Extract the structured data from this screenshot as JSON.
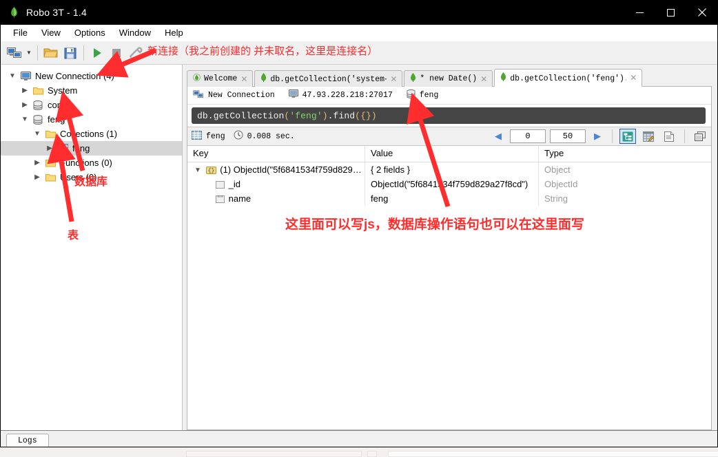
{
  "window": {
    "title": "Robo 3T - 1.4",
    "app_icon": "robomongo-leaf-icon",
    "controls": {
      "minimize": "─",
      "maximize": "□",
      "close": "✕"
    }
  },
  "menu": {
    "items": [
      {
        "label": "File"
      },
      {
        "label": "View"
      },
      {
        "label": "Options"
      },
      {
        "label": "Window"
      },
      {
        "label": "Help"
      }
    ]
  },
  "toolbar": {
    "buttons": [
      {
        "name": "connect-button",
        "icon": "computers-connect-icon",
        "title": "Connect"
      },
      {
        "name": "connect-dropdown",
        "icon": "chevron-down-icon",
        "title": ""
      },
      {
        "name": "open-script-button",
        "icon": "open-folder-icon",
        "title": "Open Script"
      },
      {
        "name": "save-script-button",
        "icon": "floppy-save-icon",
        "title": "Save Script"
      },
      {
        "name": "execute-button",
        "icon": "play-green-icon",
        "title": "Execute"
      },
      {
        "name": "stop-button",
        "icon": "stop-gray-icon",
        "title": "Stop"
      },
      {
        "name": "tools-button",
        "icon": "wrench-icon",
        "title": "Tools"
      }
    ]
  },
  "explorer": {
    "tree": [
      {
        "label": "New Connection (4)",
        "icon": "computer-icon",
        "indent": 0,
        "twisty": "expanded",
        "selected": false
      },
      {
        "label": "System",
        "icon": "folder-icon",
        "indent": 1,
        "twisty": "collapsed",
        "selected": false
      },
      {
        "label": "config",
        "icon": "database-icon",
        "indent": 1,
        "twisty": "collapsed",
        "selected": false
      },
      {
        "label": "feng",
        "icon": "database-icon",
        "indent": 1,
        "twisty": "expanded",
        "selected": false
      },
      {
        "label": "Collections (1)",
        "icon": "folder-icon",
        "indent": 2,
        "twisty": "expanded",
        "selected": false
      },
      {
        "label": "feng",
        "icon": "collection-icon",
        "indent": 3,
        "twisty": "collapsed",
        "selected": true
      },
      {
        "label": "Functions (0)",
        "icon": "folder-icon",
        "indent": 2,
        "twisty": "collapsed",
        "selected": false
      },
      {
        "label": "Users (0)",
        "icon": "folder-icon",
        "indent": 2,
        "twisty": "collapsed",
        "selected": false
      }
    ]
  },
  "tabs": [
    {
      "label": "Welcome",
      "icon": "robo-leaf-icon",
      "active": false,
      "close": "✕"
    },
    {
      "label": "db.getCollection('system⋯",
      "icon": "mongo-leaf-icon",
      "active": false,
      "close": "✕"
    },
    {
      "label": "* new Date()",
      "icon": "mongo-leaf-icon",
      "active": false,
      "close": "✕"
    },
    {
      "label": "db.getCollection('feng').⋯",
      "icon": "mongo-leaf-icon",
      "active": true,
      "close": "✕"
    }
  ],
  "connection_bar": {
    "connection_name": "New Connection",
    "server_address": "47.93.228.218:27017",
    "database_name": "feng",
    "connection_icon": "computers-connect-icon",
    "server_icon": "monitor-icon",
    "database_icon": "database-icon"
  },
  "editor": {
    "code_prefix": "db.getCollection",
    "open_paren": "(",
    "string_literal": "'feng'",
    "close_paren": ")",
    "method": ".find",
    "args": "({})"
  },
  "result_toolbar": {
    "collection_label": "feng",
    "collection_icon": "collection-icon",
    "time_icon": "clock-icon",
    "time_label": "0.008 sec.",
    "prev_arrow": "◀",
    "next_arrow": "▶",
    "skip_value": "0",
    "limit_value": "50",
    "view_modes": [
      {
        "name": "tree-mode-button",
        "icon": "tree-view-icon",
        "active": true
      },
      {
        "name": "table-mode-button",
        "icon": "table-view-icon",
        "active": false
      },
      {
        "name": "text-mode-button",
        "icon": "text-view-icon",
        "active": false
      }
    ],
    "maximize_button": {
      "name": "maximize-output-button",
      "icon": "windows-stack-icon"
    }
  },
  "results": {
    "headers": {
      "key": "Key",
      "value": "Value",
      "type": "Type"
    },
    "rows": [
      {
        "key": "(1) ObjectId(\"5f6841534f759d829…",
        "value": "{ 2 fields }",
        "type": "Object",
        "icon": "object-brace-icon",
        "indent": 0,
        "twisty": "expanded"
      },
      {
        "key": "_id",
        "value": "ObjectId(\"5f6841534f759d829a27f8cd\")",
        "type": "ObjectId",
        "icon": "objectid-icon",
        "indent": 1,
        "twisty": "none"
      },
      {
        "key": "name",
        "value": "feng",
        "type": "String",
        "icon": "string-quote-icon",
        "indent": 1,
        "twisty": "none"
      }
    ]
  },
  "logs": {
    "tab_label": "Logs"
  },
  "annotations": {
    "new_connection": "新连接（我之前创建的 并未取名，这里是连接名）",
    "database": "数据库",
    "table": "表",
    "editor_note": "这里面可以写js，数据库操作语句也可以在这里面写",
    "color": "#ff2d2d"
  }
}
